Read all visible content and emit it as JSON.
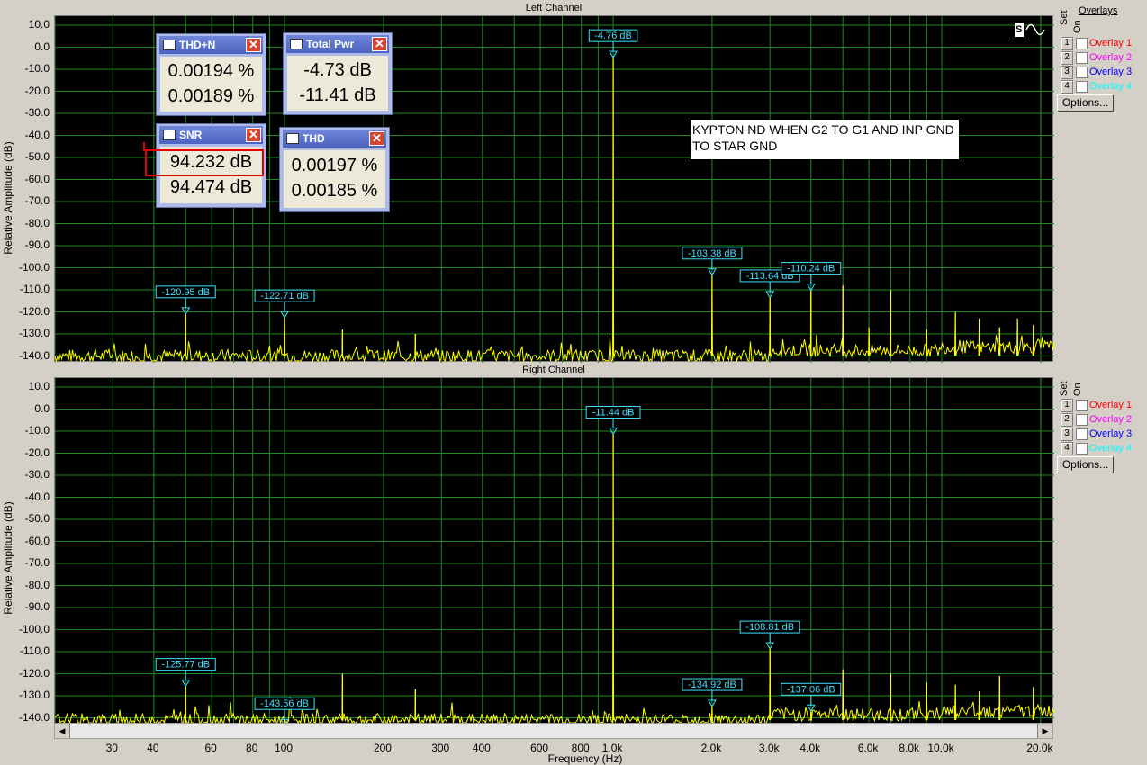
{
  "left": {
    "title": "Left Channel",
    "ylabel": "Relative Amplitude (dB)",
    "note": "KYPTON ND WHEN G2 TO G1 AND INP GND TO STAR GND",
    "markers": [
      {
        "label": "-4.76 dB",
        "freq": 1000,
        "db": -4.76
      },
      {
        "label": "-120.95 dB",
        "freq": 50,
        "db": -120.95
      },
      {
        "label": "-122.71 dB",
        "freq": 100,
        "db": -122.71
      },
      {
        "label": "-103.38 dB",
        "freq": 2000,
        "db": -103.38
      },
      {
        "label": "-113.64 dB",
        "freq": 3000,
        "db": -113.64
      },
      {
        "label": "-110.24 dB",
        "freq": 4000,
        "db": -110.24
      }
    ]
  },
  "right": {
    "title": "Right Channel",
    "ylabel": "Relative Amplitude (dB)",
    "markers": [
      {
        "label": "-11.44 dB",
        "freq": 1000,
        "db": -11.44
      },
      {
        "label": "-125.77 dB",
        "freq": 50,
        "db": -125.77
      },
      {
        "label": "-143.56 dB",
        "freq": 100,
        "db": -143.56
      },
      {
        "label": "-134.92 dB",
        "freq": 2000,
        "db": -134.92
      },
      {
        "label": "-108.81 dB",
        "freq": 3000,
        "db": -108.81
      },
      {
        "label": "-137.06 dB",
        "freq": 4000,
        "db": -137.06
      }
    ]
  },
  "y_ticks": [
    "10.0",
    "0.0",
    "-10.0",
    "-20.0",
    "-30.0",
    "-40.0",
    "-50.0",
    "-60.0",
    "-70.0",
    "-80.0",
    "-90.0",
    "-100.0",
    "-110.0",
    "-120.0",
    "-130.0",
    "-140.0"
  ],
  "x_ticks": [
    "30",
    "40",
    "60",
    "80",
    "100",
    "200",
    "300",
    "400",
    "600",
    "800",
    "1.0k",
    "2.0k",
    "3.0k",
    "4.0k",
    "6.0k",
    "8.0k",
    "10.0k",
    "20.0k"
  ],
  "xlabel": "Frequency (Hz)",
  "overlays": {
    "header": "Overlays",
    "set_label": "Set",
    "on_label": "On",
    "items": [
      {
        "num": "1",
        "label": "Overlay 1",
        "color": "#ff0000"
      },
      {
        "num": "2",
        "label": "Overlay 2",
        "color": "#ff00ff"
      },
      {
        "num": "3",
        "label": "Overlay 3",
        "color": "#0000ff"
      },
      {
        "num": "4",
        "label": "Overlay 4",
        "color": "#00ffff"
      }
    ],
    "options_label": "Options..."
  },
  "meters": {
    "thdn": {
      "title": "THD+N",
      "v1": "0.00194 %",
      "v2": "0.00189 %"
    },
    "total_pwr": {
      "title": "Total Pwr",
      "v1": "-4.73 dB",
      "v2": "-11.41 dB"
    },
    "snr": {
      "title": "SNR",
      "v1": "94.232 dB",
      "v2": "94.474 dB"
    },
    "thd": {
      "title": "THD",
      "v1": "0.00197 %",
      "v2": "0.00185 %"
    }
  },
  "chart_data": [
    {
      "type": "line",
      "title": "Left Channel",
      "xlabel": "Frequency (Hz)",
      "ylabel": "Relative Amplitude (dB)",
      "x_scale": "log",
      "xlim": [
        20,
        22000
      ],
      "ylim": [
        -145,
        10
      ],
      "grid": true,
      "series": [
        {
          "name": "Left",
          "color": "#ffff00",
          "peaks": [
            [
              50,
              -121
            ],
            [
              100,
              -122.7
            ],
            [
              150,
              -128
            ],
            [
              250,
              -130
            ],
            [
              1000,
              -4.76
            ],
            [
              2000,
              -103.4
            ],
            [
              3000,
              -113.6
            ],
            [
              4000,
              -110.2
            ],
            [
              5000,
              -108
            ],
            [
              6000,
              -127
            ],
            [
              7000,
              -110
            ],
            [
              9000,
              -128
            ],
            [
              11000,
              -120
            ],
            [
              13000,
              -123
            ],
            [
              15000,
              -127
            ],
            [
              17000,
              -123
            ],
            [
              19000,
              -126
            ]
          ],
          "noise_floor": -140
        }
      ]
    },
    {
      "type": "line",
      "title": "Right Channel",
      "xlabel": "Frequency (Hz)",
      "ylabel": "Relative Amplitude (dB)",
      "x_scale": "log",
      "xlim": [
        20,
        22000
      ],
      "ylim": [
        -145,
        10
      ],
      "grid": true,
      "series": [
        {
          "name": "Right",
          "color": "#ffff00",
          "peaks": [
            [
              50,
              -125.8
            ],
            [
              100,
              -143.6
            ],
            [
              150,
              -120
            ],
            [
              250,
              -127
            ],
            [
              1000,
              -11.44
            ],
            [
              2000,
              -134.9
            ],
            [
              3000,
              -108.8
            ],
            [
              4000,
              -137.1
            ],
            [
              5000,
              -118
            ],
            [
              7000,
              -120
            ],
            [
              9000,
              -124
            ],
            [
              11000,
              -125
            ],
            [
              13000,
              -128
            ],
            [
              15000,
              -121
            ],
            [
              19000,
              -126
            ]
          ],
          "noise_floor": -141
        }
      ]
    }
  ]
}
